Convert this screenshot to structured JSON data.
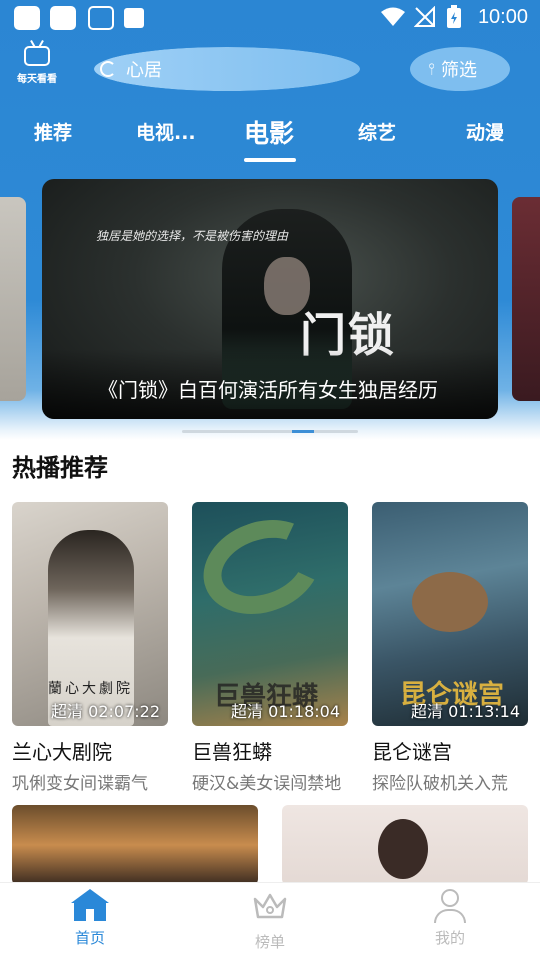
{
  "status_bar": {
    "time": "10:00"
  },
  "header": {
    "logo_text": "每天看看",
    "search_placeholder": "心居",
    "filter_label": "筛选"
  },
  "tabs": [
    {
      "label": "推荐",
      "active": false
    },
    {
      "label": "电视...",
      "active": false
    },
    {
      "label": "电影",
      "active": true
    },
    {
      "label": "综艺",
      "active": false
    },
    {
      "label": "动漫",
      "active": false
    }
  ],
  "banner": {
    "caption": "《门锁》白百何演活所有女生独居经历",
    "poster_tagline": "独居是她的选择，不是被伤害的理由",
    "poster_title": "门锁"
  },
  "section": {
    "title": "热播推荐"
  },
  "movies": [
    {
      "title": "兰心大剧院",
      "subtitle": "巩俐变女间谍霸气",
      "badge": "超清 02:07:22",
      "poster_text": "蘭心大劇院"
    },
    {
      "title": "巨兽狂蟒",
      "subtitle": "硬汉&美女误闯禁地",
      "badge": "超清 01:18:04",
      "poster_text": "巨兽狂蟒"
    },
    {
      "title": "昆仑谜宫",
      "subtitle": "探险队破机关入荒",
      "badge": "超清 01:13:14",
      "poster_text": "昆仑谜宫"
    }
  ],
  "bottom_nav": [
    {
      "label": "首页",
      "active": true,
      "color": "#2a88d8"
    },
    {
      "label": "榜单",
      "active": false,
      "color": "#bbbbbb"
    },
    {
      "label": "我的",
      "active": false,
      "color": "#bbbbbb"
    }
  ],
  "colors": {
    "primary": "#2b86d3",
    "accent": "#2a88d8"
  }
}
